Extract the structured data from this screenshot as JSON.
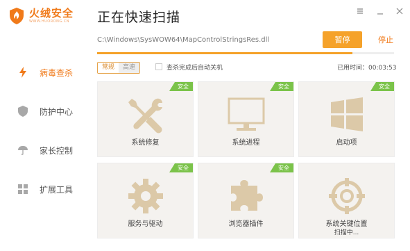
{
  "app": {
    "name": "火绒安全",
    "url": "WWW.HUORONG.CN"
  },
  "title": "正在快速扫描",
  "window_controls": [
    "menu",
    "minimize",
    "close"
  ],
  "sidebar": {
    "items": [
      {
        "label": "病毒查杀",
        "icon": "lightning-icon",
        "active": true
      },
      {
        "label": "防护中心",
        "icon": "shield-icon",
        "active": false
      },
      {
        "label": "家长控制",
        "icon": "umbrella-icon",
        "active": false
      },
      {
        "label": "扩展工具",
        "icon": "grid-icon",
        "active": false
      }
    ]
  },
  "scan": {
    "current_file": "C:\\Windows\\SysWOW64\\MapControlStringsRes.dll",
    "pause_label": "暂停",
    "stop_label": "停止",
    "progress_fraction": 0.86
  },
  "mode": {
    "normal": "常规",
    "fast": "高速",
    "selected": "常规"
  },
  "auto_shutdown": {
    "label": "查杀完成后自动关机",
    "checked": false
  },
  "elapsed": "已用时间：00:03:53",
  "colors": {
    "accent": "#f07a1a",
    "button": "#f5a22a",
    "safe_badge": "#7bc34a",
    "icon": "#dcc9a8"
  },
  "cards": [
    {
      "name": "系统修复",
      "badge": "安全",
      "icon": "tools-icon"
    },
    {
      "name": "系统进程",
      "badge": "安全",
      "icon": "monitor-icon"
    },
    {
      "name": "启动项",
      "badge": "安全",
      "icon": "windows-icon"
    },
    {
      "name": "服务与驱动",
      "badge": "安全",
      "icon": "gear-icon"
    },
    {
      "name": "浏览器插件",
      "badge": "安全",
      "icon": "puzzle-icon"
    },
    {
      "name": "系统关键位置",
      "sub": "扫描中...",
      "icon": "target-icon"
    }
  ]
}
